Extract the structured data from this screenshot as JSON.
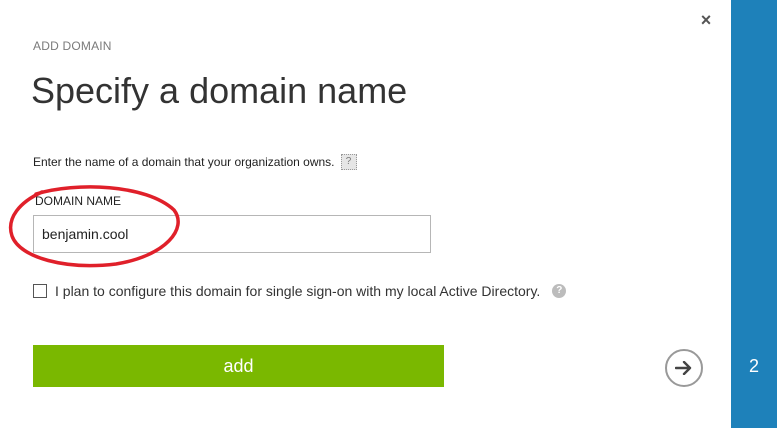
{
  "dialog": {
    "section_label": "ADD DOMAIN",
    "title": "Specify a domain name",
    "help_text": "Enter the name of a domain that your organization owns.",
    "field_label": "DOMAIN NAME",
    "domain_value": "benjamin.cool",
    "sso_checkbox_label": "I plan to configure this domain for single sign-on with my local Active Directory.",
    "sso_checked": false,
    "add_label": "add",
    "close_symbol": "×",
    "step_number": "2"
  },
  "icons": {
    "help": "help-icon",
    "close": "close-icon",
    "next": "arrow-right-icon"
  },
  "colors": {
    "accent_green": "#7ab800",
    "step_bar_blue": "#1e81ba",
    "annotation_red": "#e0202a"
  }
}
